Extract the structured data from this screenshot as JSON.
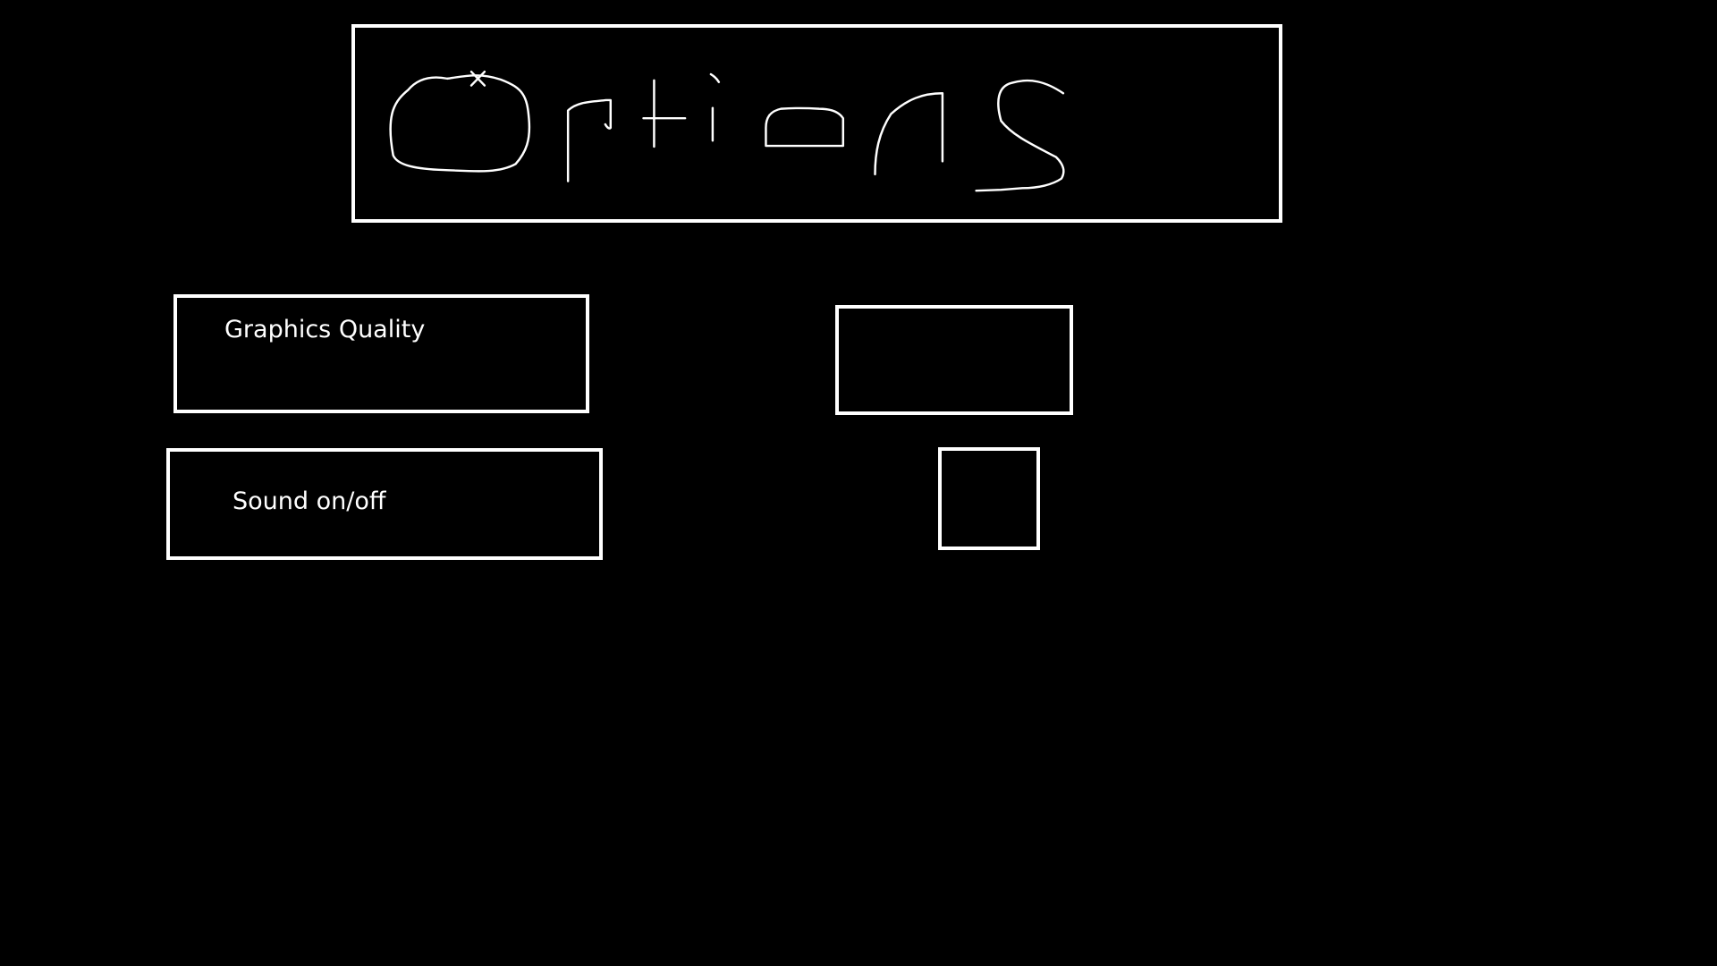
{
  "screen": {
    "title": "Options",
    "background_color": "#000000",
    "line_color": "#ffffff"
  },
  "options": [
    {
      "label": "Graphics Quality",
      "control_type": "value-box",
      "value": ""
    },
    {
      "label": "Sound on/off",
      "control_type": "toggle-checkbox",
      "checked": false
    }
  ]
}
